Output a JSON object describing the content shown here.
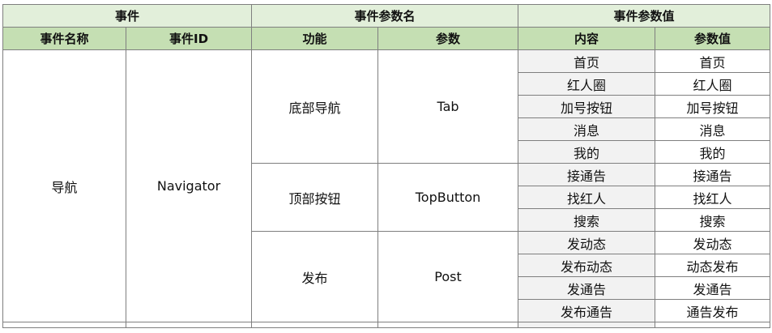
{
  "header": {
    "group_event": "事件",
    "group_param_name": "事件参数名",
    "group_param_value": "事件参数值",
    "col_event_name": "事件名称",
    "col_event_id": "事件ID",
    "col_function": "功能",
    "col_param": "参数",
    "col_content": "内容",
    "col_param_value": "参数值"
  },
  "event": {
    "name": "导航",
    "id": "Navigator"
  },
  "groups": [
    {
      "function": "底部导航",
      "param": "Tab",
      "rows": [
        {
          "content": "首页",
          "value": "首页"
        },
        {
          "content": "红人圈",
          "value": "红人圈"
        },
        {
          "content": "加号按钮",
          "value": "加号按钮"
        },
        {
          "content": "消息",
          "value": "消息"
        },
        {
          "content": "我的",
          "value": "我的"
        }
      ]
    },
    {
      "function": "顶部按钮",
      "param": "TopButton",
      "rows": [
        {
          "content": "接通告",
          "value": "接通告"
        },
        {
          "content": "找红人",
          "value": "找红人"
        },
        {
          "content": "搜索",
          "value": "搜索"
        }
      ]
    },
    {
      "function": "发布",
      "param": "Post",
      "rows": [
        {
          "content": "发动态",
          "value": "发动态"
        },
        {
          "content": "发布动态",
          "value": "动态发布"
        },
        {
          "content": "发通告",
          "value": "发通告"
        },
        {
          "content": "发布通告",
          "value": "通告发布"
        }
      ]
    }
  ]
}
